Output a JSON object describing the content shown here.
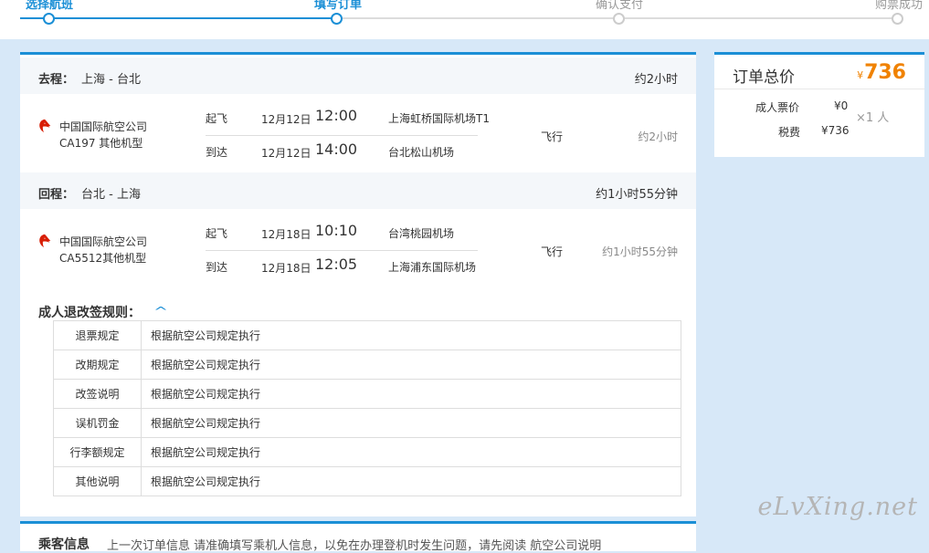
{
  "steps": [
    {
      "label": "选择航班",
      "state": "active"
    },
    {
      "label": "填写订单",
      "state": "active"
    },
    {
      "label": "确认支付",
      "state": "inactive"
    },
    {
      "label": "购票成功",
      "state": "inactive"
    }
  ],
  "outbound": {
    "label": "去程：",
    "route": "上海 - 台北",
    "duration": "约2小时",
    "airline": "中国国际航空公司",
    "flight": "CA197  其他机型",
    "dep": {
      "kw": "起飞",
      "date": "12月12日",
      "time": "12:00",
      "airport": "上海虹桥国际机场T1"
    },
    "arr": {
      "kw": "到达",
      "date": "12月12日",
      "time": "14:00",
      "airport": "台北松山机场"
    },
    "fly": "飞行",
    "seg_duration": "约2小时"
  },
  "return": {
    "label": "回程：",
    "route": "台北 - 上海",
    "duration": "约1小时55分钟",
    "airline": "中国国际航空公司",
    "flight": "CA5512其他机型",
    "dep": {
      "kw": "起飞",
      "date": "12月18日",
      "time": "10:10",
      "airport": "台湾桃园机场"
    },
    "arr": {
      "kw": "到达",
      "date": "12月18日",
      "time": "12:05",
      "airport": "上海浦东国际机场"
    },
    "fly": "飞行",
    "seg_duration": "约1小时55分钟"
  },
  "rules": {
    "title": "成人退改签规则：",
    "rows": [
      {
        "k": "退票规定",
        "v": "根据航空公司规定执行"
      },
      {
        "k": "改期规定",
        "v": "根据航空公司规定执行"
      },
      {
        "k": "改签说明",
        "v": "根据航空公司规定执行"
      },
      {
        "k": "误机罚金",
        "v": "根据航空公司规定执行"
      },
      {
        "k": "行李额规定",
        "v": "根据航空公司规定执行"
      },
      {
        "k": "其他说明",
        "v": "根据航空公司规定执行"
      }
    ]
  },
  "price": {
    "title": "订单总价",
    "currency": "¥",
    "total": "736",
    "adult_label": "成人票价",
    "adult_value": "¥0",
    "tax_label": "税费",
    "tax_value": "¥736",
    "multiplier": "×1 人"
  },
  "passenger": {
    "title": "乘客信息",
    "note": "上一次订单信息   请准确填写乘机人信息，以免在办理登机时发生问题，请先阅读 航空公司说明"
  },
  "watermark": "eLvXing.net",
  "colors": {
    "accent": "#1b8fd6",
    "price": "#f08200"
  }
}
